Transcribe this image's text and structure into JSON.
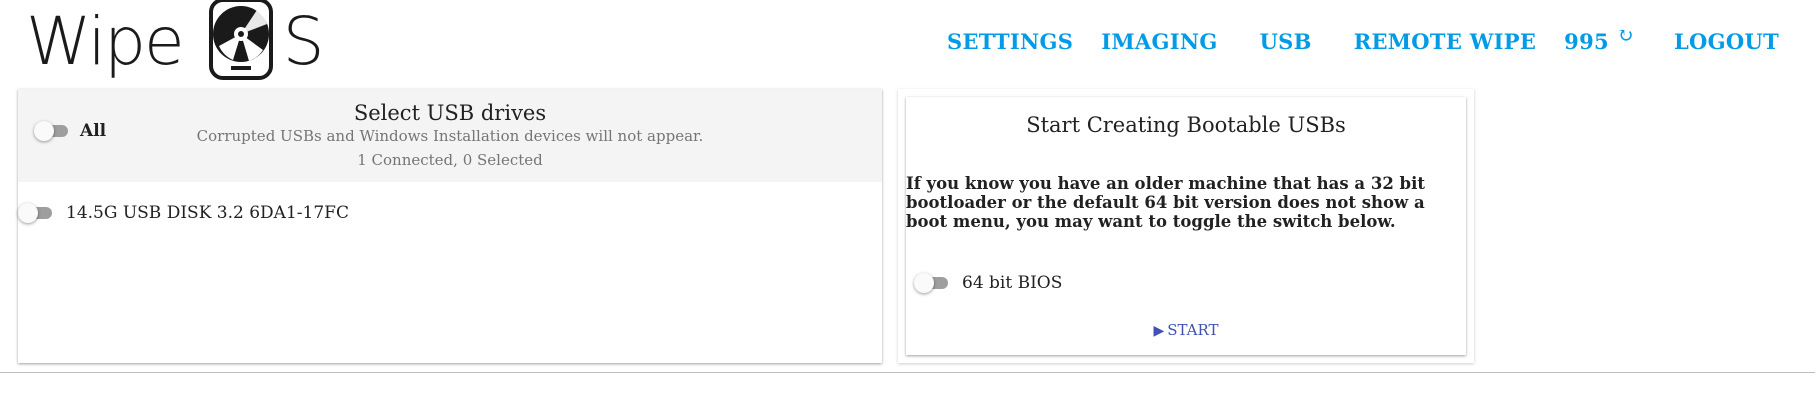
{
  "brand": {
    "logo_left": "Wipe",
    "logo_right": "S"
  },
  "nav": {
    "settings": "SETTINGS",
    "imaging": "IMAGING",
    "usb": "USB",
    "remote_wipe": "REMOTE WIPE",
    "count": "995",
    "logout": "LOGOUT"
  },
  "usb_panel": {
    "all_label": "All",
    "title": "Select USB drives",
    "subtitle": "Corrupted USBs and Windows Installation devices will not appear.",
    "status": "1 Connected, 0 Selected",
    "drives": [
      {
        "label": "14.5G USB DISK 3.2 6DA1-17FC",
        "selected": false
      }
    ]
  },
  "bootable_panel": {
    "title": "Start Creating Bootable USBs",
    "info": "If you know you have an older machine that has a 32 bit bootloader or the default 64 bit version does not show a boot menu, you may want to toggle the switch below.",
    "bios_label": "64 bit BIOS",
    "start_label": "START"
  },
  "colors": {
    "nav": "#039be5",
    "start": "#3f51b5",
    "header_bg": "#f4f4f4",
    "toggle_track": "#9e9e9e"
  },
  "icons": {
    "logo_disk": "hard-disk-icon",
    "refresh": "refresh-icon",
    "start": "play-icon"
  }
}
